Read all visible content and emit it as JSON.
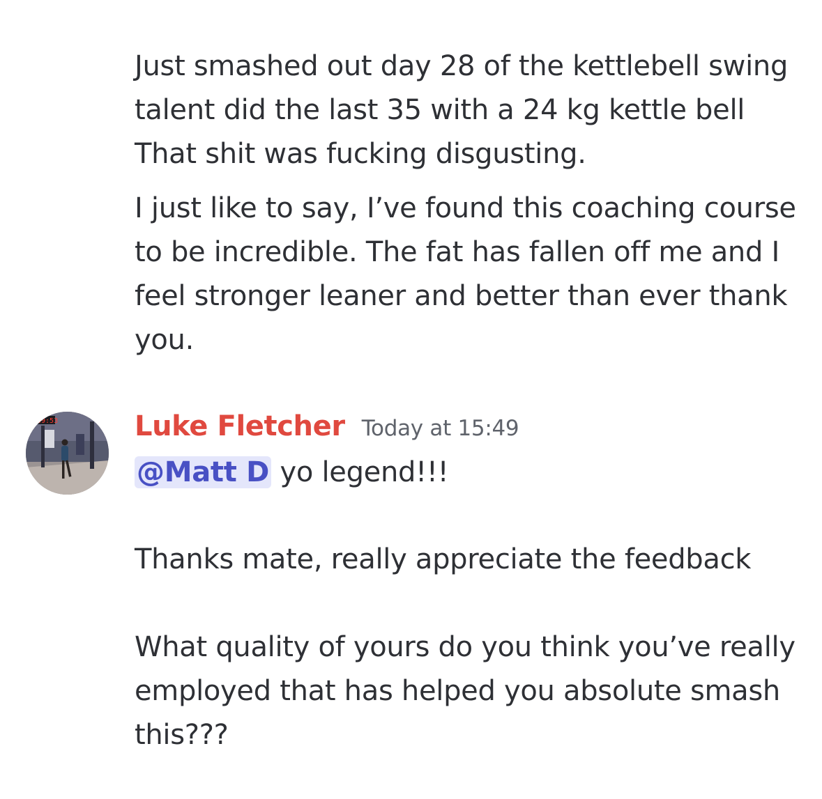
{
  "messages": {
    "previous": {
      "paragraph_1": "Just smashed out day 28 of the kettlebell swing talent did the last 35 with a 24 kg kettle bell That shit was fucking disgusting.",
      "paragraph_2": "I just like to say, I’ve found this coaching course to be incredible. The fat has fallen off me and I feel stronger leaner and better than ever thank you."
    },
    "reply": {
      "author": "Luke Fletcher",
      "author_color": "#e0493f",
      "timestamp": "Today at 15:49",
      "avatar_overlay_text": "39:53",
      "mention": "@Matt D",
      "first_line_rest": " yo legend!!!",
      "paragraph_2": "Thanks mate, really appreciate the feedback",
      "paragraph_3": "What quality of yours do you think you’ve really employed that has helped you absolute smash this???"
    }
  }
}
